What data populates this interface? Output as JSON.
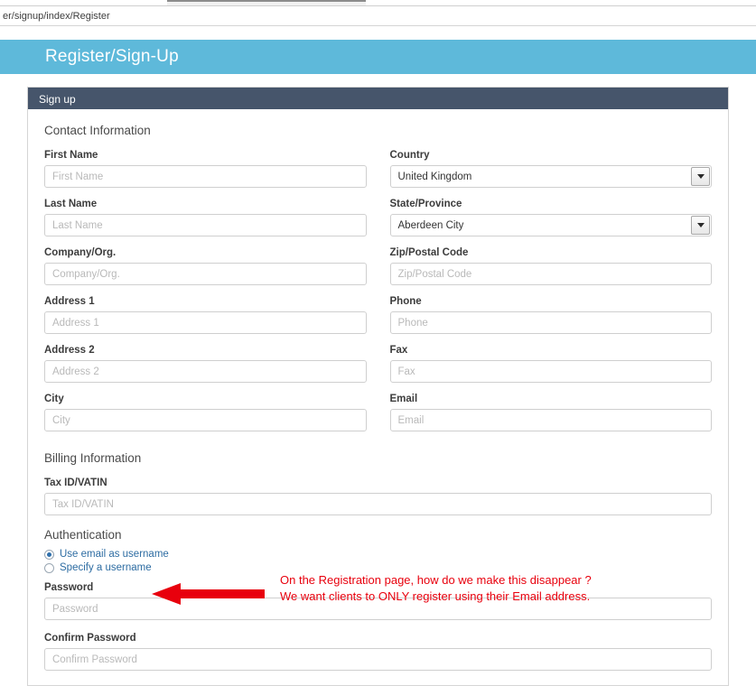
{
  "browser": {
    "url": "er/signup/index/Register"
  },
  "banner": {
    "title": "Register/Sign-Up"
  },
  "panel": {
    "heading": "Sign up"
  },
  "sections": {
    "contact": "Contact Information",
    "billing": "Billing Information",
    "authentication": "Authentication"
  },
  "fields": {
    "first_name": {
      "label": "First Name",
      "placeholder": "First Name",
      "value": ""
    },
    "country": {
      "label": "Country",
      "selected": "United Kingdom"
    },
    "last_name": {
      "label": "Last Name",
      "placeholder": "Last Name",
      "value": ""
    },
    "state_province": {
      "label": "State/Province",
      "selected": "Aberdeen City"
    },
    "company_org": {
      "label": "Company/Org.",
      "placeholder": "Company/Org.",
      "value": ""
    },
    "zip_postal": {
      "label": "Zip/Postal Code",
      "placeholder": "Zip/Postal Code",
      "value": ""
    },
    "address1": {
      "label": "Address 1",
      "placeholder": "Address 1",
      "value": ""
    },
    "phone": {
      "label": "Phone",
      "placeholder": "Phone",
      "value": ""
    },
    "address2": {
      "label": "Address 2",
      "placeholder": "Address 2",
      "value": ""
    },
    "fax": {
      "label": "Fax",
      "placeholder": "Fax",
      "value": ""
    },
    "city": {
      "label": "City",
      "placeholder": "City",
      "value": ""
    },
    "email": {
      "label": "Email",
      "placeholder": "Email",
      "value": ""
    },
    "tax_id": {
      "label": "Tax ID/VATIN",
      "placeholder": "Tax ID/VATIN",
      "value": ""
    },
    "password": {
      "label": "Password",
      "placeholder": "Password",
      "value": ""
    },
    "confirm_password": {
      "label": "Confirm Password",
      "placeholder": "Confirm Password",
      "value": ""
    }
  },
  "auth_options": {
    "use_email": "Use email as username",
    "specify_username": "Specify a username",
    "selected": "use_email"
  },
  "annotation": {
    "line1": "On the Registration page, how do we make this disappear ?",
    "line2": "We want clients to ONLY register using their Email address.",
    "color": "#e8000d"
  },
  "colors": {
    "banner": "#5eb9da",
    "panel_heading": "#46556b",
    "link": "#2d6ca2"
  }
}
